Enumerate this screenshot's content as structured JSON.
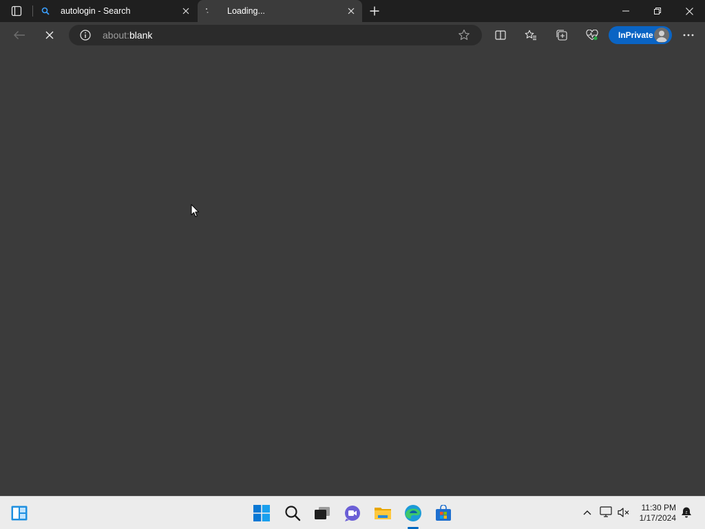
{
  "browser": {
    "tabs": [
      {
        "title": "autologin - Search",
        "favicon": "search-icon",
        "active": false
      },
      {
        "title": "Loading...",
        "favicon": "loading-spinner-icon",
        "active": true
      }
    ],
    "address": {
      "prefix": "about:",
      "host": "blank"
    },
    "inprivate_label": "InPrivate",
    "accent_color": "#0a64c4"
  },
  "taskbar": {
    "apps": [
      "widgets-icon",
      "start-icon",
      "search-icon",
      "task-view-icon",
      "chat-icon",
      "file-explorer-icon",
      "edge-icon",
      "store-icon"
    ],
    "clock": {
      "time": "11:30 PM",
      "date": "1/17/2024"
    }
  }
}
